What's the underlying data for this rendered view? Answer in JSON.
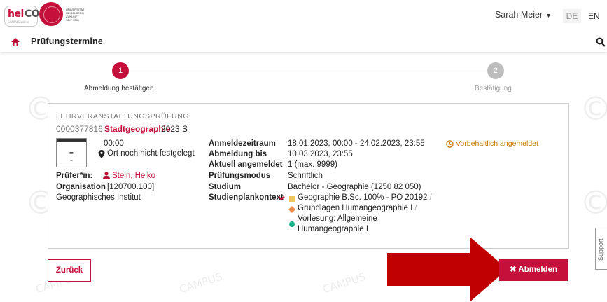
{
  "header": {
    "logo_prefix": "hei",
    "logo_suffix": "CO",
    "logo_tagline": "CAMPUS online",
    "university_lines": [
      "UNIVERSITÄT",
      "HEIDELBERG",
      "ZUKUNFT",
      "SEIT 1386"
    ],
    "user_name": "Sarah Meier",
    "lang_de": "DE",
    "lang_en": "EN"
  },
  "breadcrumb": {
    "title": "Prüfungstermine"
  },
  "stepper": {
    "step1_number": "1",
    "step1_label": "Abmeldung bestätigen",
    "step2_number": "2",
    "step2_label": "Bestätigung",
    "active_step": 1
  },
  "exam": {
    "type": "LEHRVERANSTALTUNGSPRÜFUNG",
    "number": "0000377816",
    "title": "Stadtgeographie",
    "semester": "2023 S",
    "date_top": "-",
    "date_bottom": "-",
    "time": "00:00",
    "location": "Ort noch nicht festgelegt",
    "examiner_label": "Prüfer*in:",
    "examiner_name": "Stein, Heiko",
    "organisation_label": "Organisation",
    "organisation_code": "[120700.100]",
    "organisation_name": "Geographisches Institut",
    "details": [
      {
        "label": "Anmeldezeitraum",
        "value": "18.01.2023, 00:00 - 24.02.2023, 23:55"
      },
      {
        "label": "Abmeldung bis",
        "value": "10.03.2023, 23:55"
      },
      {
        "label": "Aktuell angemeldet",
        "value": "1 (max. 9999)"
      },
      {
        "label": "Prüfungsmodus",
        "value": "Schriftlich"
      },
      {
        "label": "Studium",
        "value": "Bachelor - Geographie (1250 82 050)"
      },
      {
        "label": "Studienplankontext",
        "value": ""
      }
    ],
    "context": {
      "item1": "Geographie B.Sc. 100% - PO 20192",
      "item2": "Grundlagen Humangeographie I",
      "item3_line1": "Vorlesung: Allgemeine",
      "item3_line2": "Humangeographie I",
      "separator": "/"
    },
    "status": "Vorbehaltlich angemeldet"
  },
  "buttons": {
    "back": "Zurück",
    "sign_off": "Abmelden"
  },
  "support": "Support",
  "colors": {
    "accent": "#c4103a",
    "status": "#c67a00",
    "arrow": "#c00000"
  }
}
